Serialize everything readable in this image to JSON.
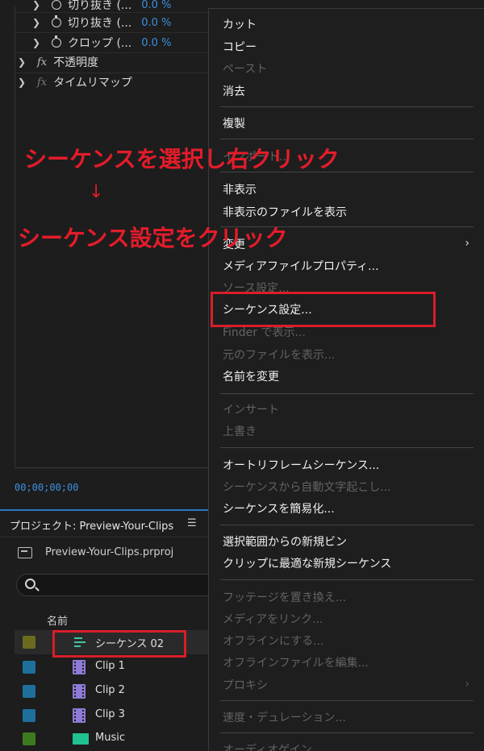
{
  "effect_controls": {
    "rows": [
      {
        "label": "切り抜き (...",
        "value": "0.0 %"
      },
      {
        "label": "切り抜き (...",
        "value": "0.0 %"
      },
      {
        "label": "クロップ (...",
        "value": "0.0 %"
      }
    ],
    "fx_rows": [
      {
        "label": "不透明度"
      },
      {
        "label": "タイムリマップ"
      }
    ],
    "timecode": "00;00;00;00"
  },
  "project_panel": {
    "tab_title": "プロジェクト: Preview-Your-Clips",
    "menu_icon": "hamburger-icon",
    "file_name": "Preview-Your-Clips.prproj",
    "search_placeholder": "",
    "column_header": "名前",
    "items": [
      {
        "name": "シーケンス 02",
        "label_color": "#6b6b1f",
        "icon": "sequence-icon"
      },
      {
        "name": "Clip 1",
        "label_color": "#1d6f9c",
        "icon": "clip-icon"
      },
      {
        "name": "Clip 2",
        "label_color": "#1d6f9c",
        "icon": "clip-icon"
      },
      {
        "name": "Clip 3",
        "label_color": "#1d6f9c",
        "icon": "clip-icon"
      },
      {
        "name": "Music",
        "label_color": "#3d7a1f",
        "icon": "audio-icon"
      }
    ]
  },
  "context_menu": {
    "items": [
      {
        "label": "カット",
        "enabled": true
      },
      {
        "label": "コピー",
        "enabled": true
      },
      {
        "label": "ペースト",
        "enabled": false
      },
      {
        "label": "消去",
        "enabled": true
      },
      {
        "label": "複製",
        "enabled": true
      },
      {
        "label": "インポート...",
        "enabled": false
      },
      {
        "label": "非表示",
        "enabled": true
      },
      {
        "label": "非表示のファイルを表示",
        "enabled": true
      },
      {
        "label": "変更",
        "enabled": true,
        "submenu": true
      },
      {
        "label": "メディアファイルプロパティ...",
        "enabled": true
      },
      {
        "label": "ソース設定...",
        "enabled": false
      },
      {
        "label": "シーケンス設定...",
        "enabled": true
      },
      {
        "label": "Finder で表示...",
        "enabled": false
      },
      {
        "label": "元のファイルを表示...",
        "enabled": false
      },
      {
        "label": "名前を変更",
        "enabled": true
      },
      {
        "label": "インサート",
        "enabled": false
      },
      {
        "label": "上書き",
        "enabled": false
      },
      {
        "label": "オートリフレームシーケンス...",
        "enabled": true
      },
      {
        "label": "シーケンスから自動文字起こし...",
        "enabled": false
      },
      {
        "label": "シーケンスを簡易化...",
        "enabled": true
      },
      {
        "label": "選択範囲からの新規ビン",
        "enabled": true
      },
      {
        "label": "クリップに最適な新規シーケンス",
        "enabled": true
      },
      {
        "label": "フッテージを置き換え...",
        "enabled": false
      },
      {
        "label": "メディアをリンク...",
        "enabled": false
      },
      {
        "label": "オフラインにする...",
        "enabled": false
      },
      {
        "label": "オフラインファイルを編集...",
        "enabled": false
      },
      {
        "label": "プロキシ",
        "enabled": false,
        "submenu": true
      },
      {
        "label": "速度・デュレーション...",
        "enabled": false
      },
      {
        "label": "オーディオゲイン...",
        "enabled": false
      }
    ],
    "submenu_arrow": "›"
  },
  "annotations": {
    "line1": "シーケンスを選択し右クリック",
    "arrow": "↓",
    "line2": "シーケンス設定をクリック",
    "highlight_color": "#d81e2a"
  }
}
